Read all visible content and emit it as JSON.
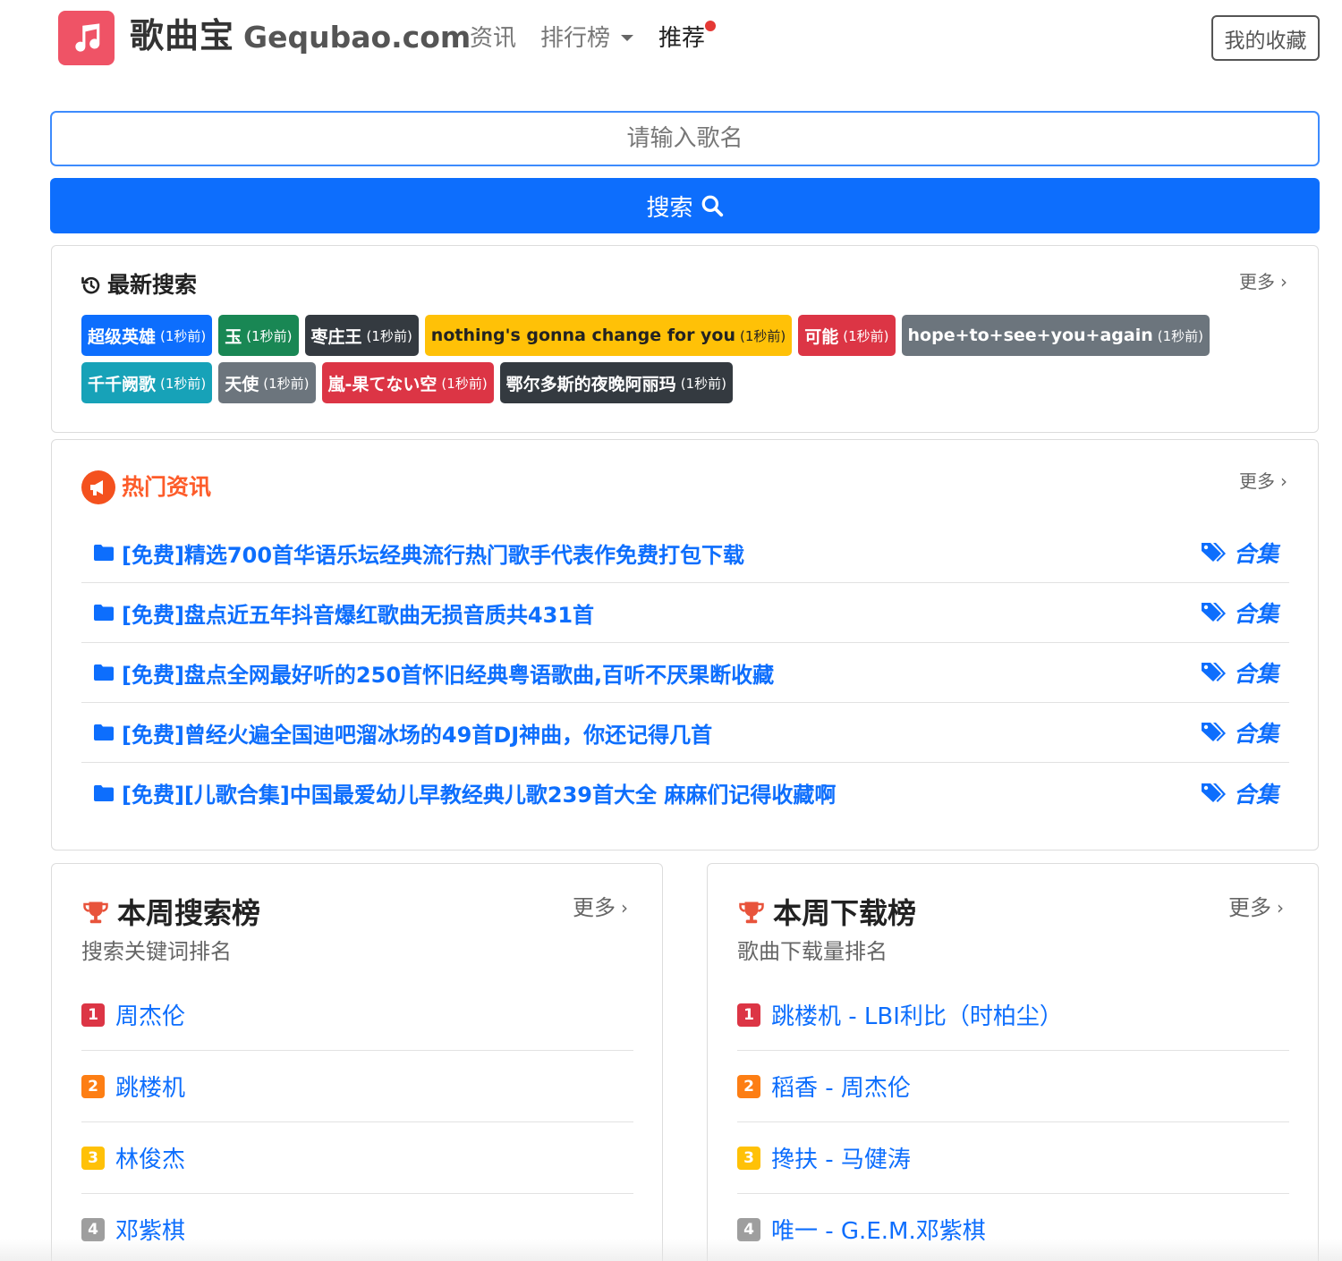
{
  "header": {
    "brand_cn": "歌曲宝",
    "brand_en": "Gequbao.com",
    "nav": {
      "news": "资讯",
      "rank": "排行榜",
      "recommend": "推荐"
    },
    "favorites_label": "我的收藏"
  },
  "search": {
    "placeholder": "请输入歌名",
    "button_label": "搜索"
  },
  "recent": {
    "title": "最新搜索",
    "more": "更多",
    "tags": [
      {
        "label": "超级英雄",
        "time": "(1秒前)",
        "color": "#0d6efd",
        "text_dark": false
      },
      {
        "label": "玉",
        "time": "(1秒前)",
        "color": "#198754",
        "text_dark": false
      },
      {
        "label": "枣庄王",
        "time": "(1秒前)",
        "color": "#343a40",
        "text_dark": false
      },
      {
        "label": "nothing's gonna change for you",
        "time": "(1秒前)",
        "color": "#ffc107",
        "text_dark": true
      },
      {
        "label": "可能",
        "time": "(1秒前)",
        "color": "#dc3545",
        "text_dark": false
      },
      {
        "label": "hope+to+see+you+again",
        "time": "(1秒前)",
        "color": "#6c757d",
        "text_dark": false
      },
      {
        "label": "千千阙歌",
        "time": "(1秒前)",
        "color": "#17a2b8",
        "text_dark": false
      },
      {
        "label": "天使",
        "time": "(1秒前)",
        "color": "#6c757d",
        "text_dark": false
      },
      {
        "label": "嵐-果てない空",
        "time": "(1秒前)",
        "color": "#dc3545",
        "text_dark": false
      },
      {
        "label": "鄂尔多斯的夜晚阿丽玛",
        "time": "(1秒前)",
        "color": "#343a40",
        "text_dark": false
      }
    ]
  },
  "news": {
    "title": "热门资讯",
    "more": "更多",
    "items": [
      {
        "title": "[免费]精选700首华语乐坛经典流行热门歌手代表作免费打包下载",
        "tag": "合集"
      },
      {
        "title": "[免费]盘点近五年抖音爆红歌曲无损音质共431首",
        "tag": "合集"
      },
      {
        "title": "[免费]盘点全网最好听的250首怀旧经典粤语歌曲,百听不厌果断收藏",
        "tag": "合集"
      },
      {
        "title": "[免费]曾经火遍全国迪吧溜冰场的49首DJ神曲，你还记得几首",
        "tag": "合集"
      },
      {
        "title": "[免费][儿歌合集]中国最爱幼儿早教经典儿歌239首大全 麻麻们记得收藏啊",
        "tag": "合集"
      }
    ]
  },
  "search_rank": {
    "title": "本周搜索榜",
    "subtitle": "搜索关键词排名",
    "more": "更多",
    "items": [
      {
        "num": "1",
        "text": "周杰伦",
        "color": "#dc3545"
      },
      {
        "num": "2",
        "text": "跳楼机",
        "color": "#fd7e14"
      },
      {
        "num": "3",
        "text": "林俊杰",
        "color": "#ffc107"
      },
      {
        "num": "4",
        "text": "邓紫棋",
        "color": "#9e9e9e"
      }
    ]
  },
  "download_rank": {
    "title": "本周下载榜",
    "subtitle": "歌曲下载量排名",
    "more": "更多",
    "items": [
      {
        "num": "1",
        "text": "跳楼机 - LBI利比（时柏尘）",
        "color": "#dc3545"
      },
      {
        "num": "2",
        "text": "稻香 - 周杰伦",
        "color": "#fd7e14"
      },
      {
        "num": "3",
        "text": "搀扶 - 马健涛",
        "color": "#ffc107"
      },
      {
        "num": "4",
        "text": "唯一 - G.E.M.邓紫棋",
        "color": "#9e9e9e"
      }
    ]
  },
  "icons": {
    "logo": "music-note-icon",
    "search": "search-icon",
    "history": "history-icon",
    "megaphone": "megaphone-icon",
    "folder": "folder-icon",
    "tags": "tags-icon",
    "trophy": "trophy-icon",
    "chevron": "chevron-right-icon"
  },
  "colors": {
    "primary": "#0d6efd",
    "logo_bg": "#ef5366",
    "news_title": "#fd5c2a",
    "trophy": "#e8533b"
  }
}
